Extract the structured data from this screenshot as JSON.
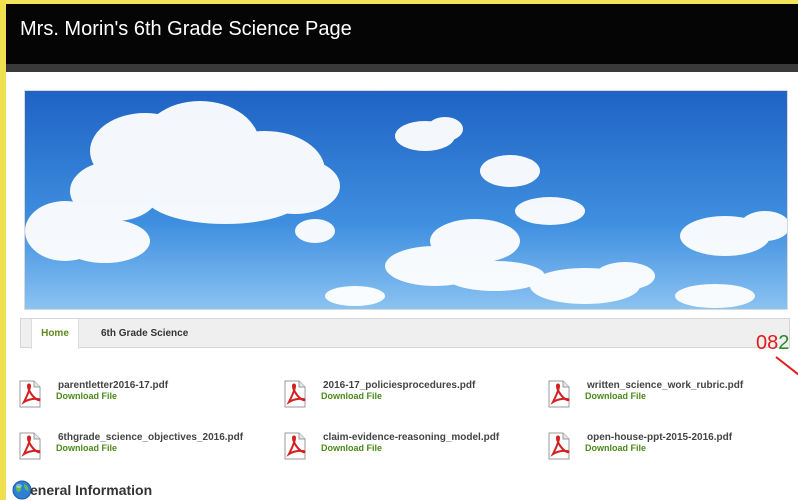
{
  "header": {
    "title": "Mrs. Morin's 6th Grade Science Page"
  },
  "nav": {
    "home": "Home",
    "science": "6th Grade Science"
  },
  "counter": {
    "red": "08",
    "green": "2"
  },
  "files": [
    {
      "name": "parentletter2016-17.pdf",
      "link": "Download File"
    },
    {
      "name": "2016-17_policiesprocedures.pdf",
      "link": "Download File"
    },
    {
      "name": "written_science_work_rubric.pdf",
      "link": "Download File"
    },
    {
      "name": "6thgrade_science_objectives_2016.pdf",
      "link": "Download File"
    },
    {
      "name": "claim-evidence-reasoning_model.pdf",
      "link": "Download File"
    },
    {
      "name": "open-house-ppt-2015-2016.pdf",
      "link": "Download File"
    }
  ],
  "section": {
    "title": "eneral Information"
  },
  "icons": {
    "pdf": "pdf-file-icon",
    "globe": "globe-icon"
  },
  "colors": {
    "accent_green": "#4c8a1a",
    "header_bg": "#050505",
    "counter_red": "#e21b1b"
  }
}
